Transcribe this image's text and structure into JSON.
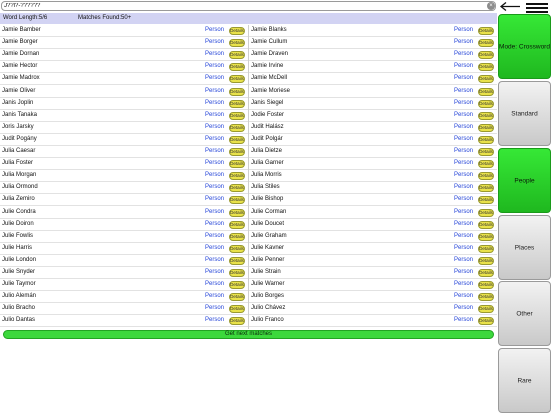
{
  "search": {
    "value": "J??l?-??????",
    "clear_icon": "×"
  },
  "info": {
    "word_length": "Word Length:5/6",
    "matches_found": "Matches Found:50+"
  },
  "rows_left": [
    {
      "name": "Jamie Bamber",
      "type": "Person",
      "details": "Details"
    },
    {
      "name": "Jamie Borger",
      "type": "Person",
      "details": "Details"
    },
    {
      "name": "Jamie Dornan",
      "type": "Person",
      "details": "Details"
    },
    {
      "name": "Jamie Hector",
      "type": "Person",
      "details": "Details"
    },
    {
      "name": "Jamie Madrox",
      "type": "Person",
      "details": "Details"
    },
    {
      "name": "Jamie Oliver",
      "type": "Person",
      "details": "Details"
    },
    {
      "name": "Janis Joplin",
      "type": "Person",
      "details": "Details"
    },
    {
      "name": "Janis Tanaka",
      "type": "Person",
      "details": "Details"
    },
    {
      "name": "Joris Jarsky",
      "type": "Person",
      "details": "Details"
    },
    {
      "name": "Judit Pogány",
      "type": "Person",
      "details": "Details"
    },
    {
      "name": "Julia Caesar",
      "type": "Person",
      "details": "Details"
    },
    {
      "name": "Julia Foster",
      "type": "Person",
      "details": "Details"
    },
    {
      "name": "Julia Morgan",
      "type": "Person",
      "details": "Details"
    },
    {
      "name": "Julia Ormond",
      "type": "Person",
      "details": "Details"
    },
    {
      "name": "Julia Zemiro",
      "type": "Person",
      "details": "Details"
    },
    {
      "name": "Julie Condra",
      "type": "Person",
      "details": "Details"
    },
    {
      "name": "Julie Doiron",
      "type": "Person",
      "details": "Details"
    },
    {
      "name": "Julie Fowlis",
      "type": "Person",
      "details": "Details"
    },
    {
      "name": "Julie Harris",
      "type": "Person",
      "details": "Details"
    },
    {
      "name": "Julie London",
      "type": "Person",
      "details": "Details"
    },
    {
      "name": "Julie Snyder",
      "type": "Person",
      "details": "Details"
    },
    {
      "name": "Julie Taymor",
      "type": "Person",
      "details": "Details"
    },
    {
      "name": "Julio Alemán",
      "type": "Person",
      "details": "Details"
    },
    {
      "name": "Julio Bracho",
      "type": "Person",
      "details": "Details"
    },
    {
      "name": "Julio Dantas",
      "type": "Person",
      "details": "Details"
    }
  ],
  "rows_right": [
    {
      "name": "Jamie Blanks",
      "type": "Person",
      "details": "Details"
    },
    {
      "name": "Jamie Cullum",
      "type": "Person",
      "details": "Details"
    },
    {
      "name": "Jamie Draven",
      "type": "Person",
      "details": "Details"
    },
    {
      "name": "Jamie Irvine",
      "type": "Person",
      "details": "Details"
    },
    {
      "name": "Jamie McDell",
      "type": "Person",
      "details": "Details"
    },
    {
      "name": "Jamie Moriese",
      "type": "Person",
      "details": "Details"
    },
    {
      "name": "Janis Siegel",
      "type": "Person",
      "details": "Details"
    },
    {
      "name": "Jodie Foster",
      "type": "Person",
      "details": "Details"
    },
    {
      "name": "Judit Halász",
      "type": "Person",
      "details": "Details"
    },
    {
      "name": "Judit Polgár",
      "type": "Person",
      "details": "Details"
    },
    {
      "name": "Julia Dietze",
      "type": "Person",
      "details": "Details"
    },
    {
      "name": "Julia Garner",
      "type": "Person",
      "details": "Details"
    },
    {
      "name": "Julia Morris",
      "type": "Person",
      "details": "Details"
    },
    {
      "name": "Julia Stiles",
      "type": "Person",
      "details": "Details"
    },
    {
      "name": "Julie Bishop",
      "type": "Person",
      "details": "Details"
    },
    {
      "name": "Julie Corman",
      "type": "Person",
      "details": "Details"
    },
    {
      "name": "Julie Doucet",
      "type": "Person",
      "details": "Details"
    },
    {
      "name": "Julie Graham",
      "type": "Person",
      "details": "Details"
    },
    {
      "name": "Julie Kavner",
      "type": "Person",
      "details": "Details"
    },
    {
      "name": "Julie Penner",
      "type": "Person",
      "details": "Details"
    },
    {
      "name": "Julie Strain",
      "type": "Person",
      "details": "Details"
    },
    {
      "name": "Julie Warner",
      "type": "Person",
      "details": "Details"
    },
    {
      "name": "Julio Borges",
      "type": "Person",
      "details": "Details"
    },
    {
      "name": "Julio Chávez",
      "type": "Person",
      "details": "Details"
    },
    {
      "name": "Julio Franco",
      "type": "Person",
      "details": "Details"
    }
  ],
  "next_button": "Get next matches",
  "side_buttons": [
    {
      "label": "Mode: Crossword",
      "style": "green"
    },
    {
      "label": "Standard",
      "style": "gray"
    },
    {
      "label": "People",
      "style": "green"
    },
    {
      "label": "Places",
      "style": "gray"
    },
    {
      "label": "Other",
      "style": "gray"
    },
    {
      "label": "Rare",
      "style": "gray"
    }
  ],
  "colors": {
    "accent_green": "#2fd42f",
    "info_bar": "#d2d3f3",
    "type_link": "#2545d8",
    "details_yellow": "#e9e24a"
  },
  "icons": {
    "back": "left-arrow-icon",
    "menu": "hamburger-menu-icon",
    "clear": "clear-icon"
  }
}
